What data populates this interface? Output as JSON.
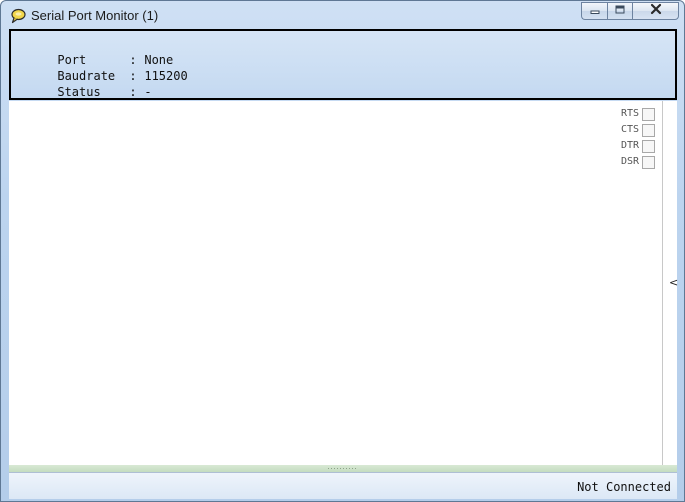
{
  "window": {
    "title": "Serial Port Monitor (1)"
  },
  "info": {
    "rows": [
      {
        "label": "Port",
        "sep": ":",
        "value": "None"
      },
      {
        "label": "Baudrate",
        "sep": ":",
        "value": "115200"
      },
      {
        "label": "Status",
        "sep": ":",
        "value": "-"
      }
    ]
  },
  "signals": [
    {
      "label": "RTS",
      "checked": false
    },
    {
      "label": "CTS",
      "checked": false
    },
    {
      "label": "DTR",
      "checked": false
    },
    {
      "label": "DSR",
      "checked": false
    }
  ],
  "side_toggle": {
    "glyph": "<"
  },
  "statusbar": {
    "text": "Not Connected"
  },
  "icons": {
    "app": "speech-bubble-icon",
    "minimize": "minimize-icon",
    "maximize": "maximize-icon",
    "close": "close-icon"
  },
  "colors": {
    "titlebar": "#c4d9f1",
    "info_panel": "#cfe0f4",
    "splitter": "#cfe3ca",
    "close_glyph": "#2a2a2a"
  }
}
